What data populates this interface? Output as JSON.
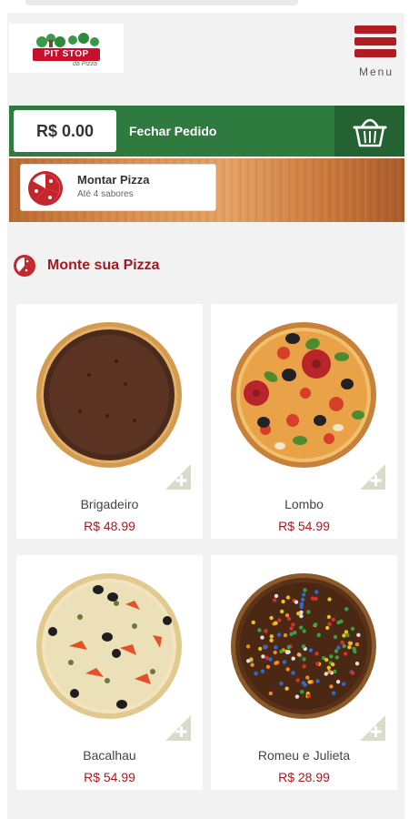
{
  "header": {
    "logo": {
      "name": "PIT STOP",
      "tagline": "da Pizza"
    },
    "menu_label": "Menu"
  },
  "order": {
    "total": "R$ 0.00",
    "close_label": "Fechar Pedido"
  },
  "build": {
    "title": "Montar Pizza",
    "subtitle": "Até 4 sabores"
  },
  "section": {
    "title": "Monte sua Pizza"
  },
  "products": [
    {
      "name": "Brigadeiro",
      "price": "R$ 48.99",
      "topping": "chocolate"
    },
    {
      "name": "Lombo",
      "price": "R$ 54.99",
      "topping": "pepperoni"
    },
    {
      "name": "Bacalhau",
      "price": "R$ 54.99",
      "topping": "cod"
    },
    {
      "name": "Romeu e Julieta",
      "price": "R$ 28.99",
      "topping": "sprinkles"
    }
  ],
  "icons": {
    "menu": "hamburger-menu-icon",
    "cart": "basket-icon",
    "build": "pizza-slice-icon",
    "section": "pizza-slice-icon",
    "add": "plus-icon"
  },
  "colors": {
    "brand_red": "#a31b1f",
    "order_green": "#2f7a3f",
    "order_green_dark": "#246232",
    "background": "#f2f2f2"
  }
}
